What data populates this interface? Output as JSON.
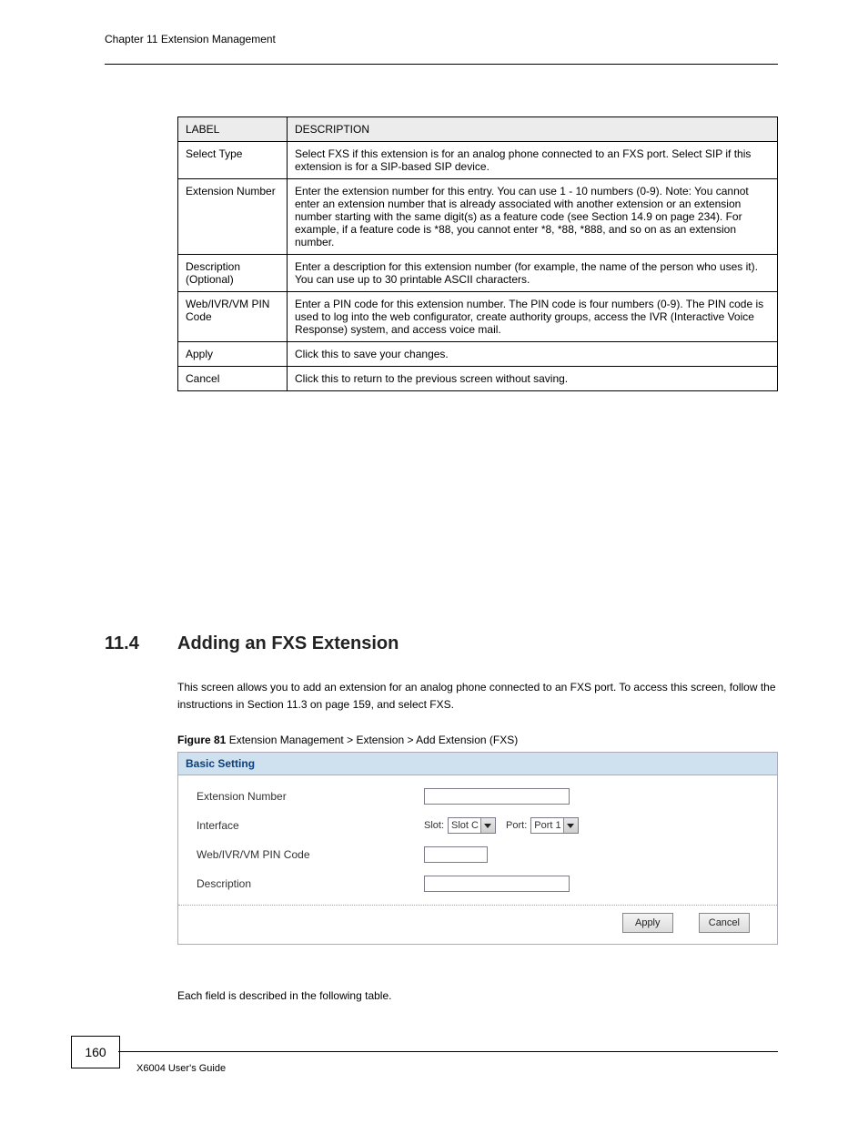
{
  "header": {
    "chapter": "Chapter 11 Extension Management"
  },
  "table": {
    "head_label": "LABEL",
    "head_desc": "DESCRIPTION",
    "rows": [
      {
        "label": "Select Type",
        "desc": "Select FXS if this extension is for an analog phone connected to an FXS port. Select SIP if this extension is for a SIP-based SIP device."
      },
      {
        "label": "Extension Number",
        "desc": "Enter the extension number for this entry. You can use 1 - 10 numbers (0-9). Note: You cannot enter an extension number that is already associated with another extension or an extension number starting with the same digit(s) as a feature code (see Section 14.9 on page 234). For example, if a feature code is *88, you cannot enter *8, *88, *888, and so on as an extension number."
      },
      {
        "label": "Description (Optional)",
        "desc": "Enter a description for this extension number (for example, the name of the person who uses it). You can use up to 30 printable ASCII characters."
      },
      {
        "label": "Web/IVR/VM PIN Code",
        "desc": "Enter a PIN code for this extension number. The PIN code is four numbers (0-9). The PIN code is used to log into the web configurator, create authority groups, access the IVR (Interactive Voice Response) system, and access voice mail."
      },
      {
        "label": "Apply",
        "desc": "Click this to save your changes."
      },
      {
        "label": "Cancel",
        "desc": "Click this to return to the previous screen without saving."
      }
    ]
  },
  "section": {
    "number": "11.4",
    "title": "Adding an FXS Extension",
    "intro": "This screen allows you to add an extension for an analog phone connected to an FXS port. To access this screen, follow the instructions in Section 11.3 on page 159, and select FXS.",
    "figure_label": "Figure 81",
    "figure_text": "   Extension Management > Extension > Add Extension (FXS)"
  },
  "panel": {
    "title": "Basic Setting",
    "rows": {
      "ext_label": "Extension Number",
      "iface_label": "Interface",
      "slot_prefix": "Slot:",
      "slot_value": "Slot C",
      "port_prefix": "Port:",
      "port_value": "Port 1",
      "pin_label": "Web/IVR/VM PIN Code",
      "desc_label": "Description"
    },
    "buttons": {
      "apply": "Apply",
      "cancel": "Cancel"
    }
  },
  "under": "Each field is described in the following table.",
  "footer": {
    "page": "160",
    "text": "X6004 User's Guide"
  }
}
